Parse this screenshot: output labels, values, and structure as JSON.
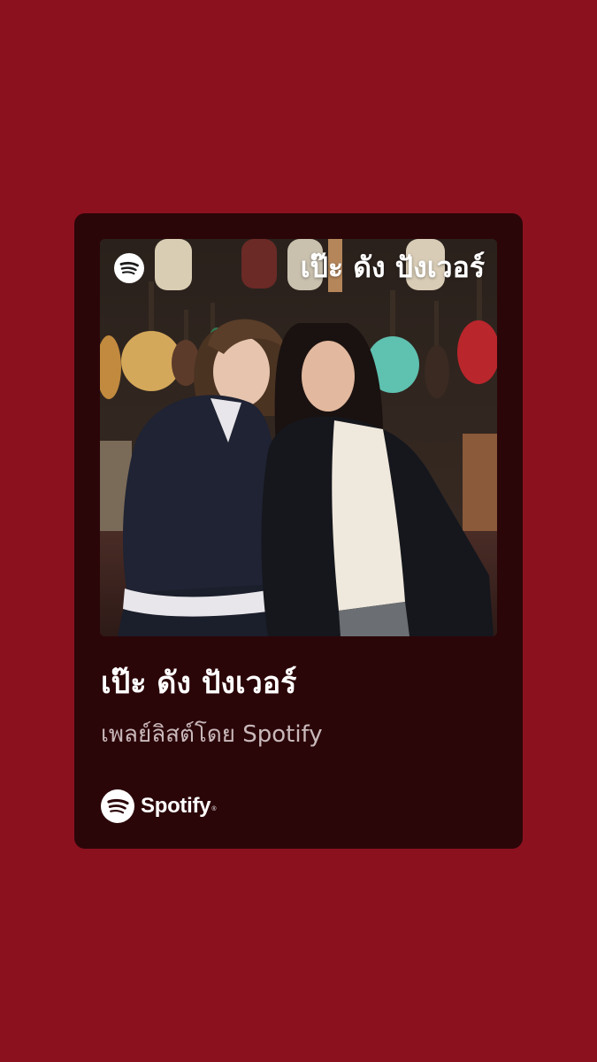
{
  "playlist": {
    "cover_title": "เป๊ะ ดัง ปังเวอร์",
    "title": "เป๊ะ ดัง ปังเวอร์",
    "subtitle": "เพลย์ลิสต์โดย Spotify"
  },
  "brand": {
    "name": "Spotify",
    "icon": "spotify-logo-icon"
  },
  "colors": {
    "background": "#8b111f",
    "card": "#2b0609",
    "title": "#ffffff",
    "subtitle": "#c9b9bb"
  }
}
